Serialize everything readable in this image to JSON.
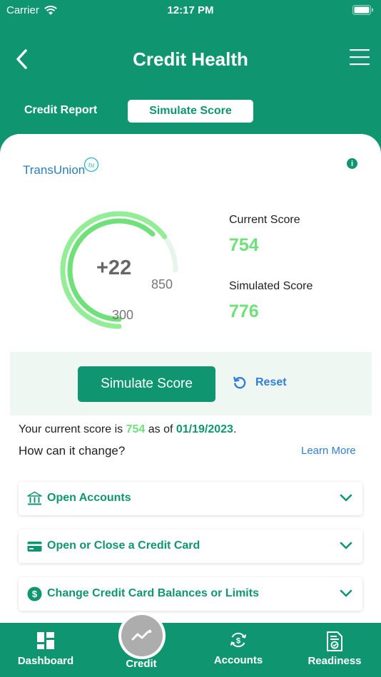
{
  "status_bar": {
    "carrier": "Carrier",
    "time": "12:17 PM"
  },
  "header": {
    "title": "Credit Health"
  },
  "tabs": [
    {
      "label": "Credit Report"
    },
    {
      "label": "Simulate Score"
    }
  ],
  "provider": {
    "name": "TransUnion",
    "mark": "tu"
  },
  "gauge": {
    "delta_label": "+22",
    "min_label": "300",
    "max_label": "850",
    "min": 300,
    "max": 850,
    "current": 754,
    "simulated": 776
  },
  "scores": {
    "current_label": "Current Score",
    "current_value": "754",
    "simulated_label": "Simulated Score",
    "simulated_value": "776"
  },
  "actions": {
    "simulate_label": "Simulate Score",
    "reset_label": "Reset"
  },
  "summary": {
    "prefix": "Your current score is ",
    "score": "754",
    "middle": " as of ",
    "date": "01/19/2023",
    "suffix": "."
  },
  "question": {
    "text": "How can it change?",
    "link": "Learn More"
  },
  "accordion": [
    {
      "label": "Open Accounts",
      "icon": "bank-icon"
    },
    {
      "label": "Open or Close a Credit Card",
      "icon": "credit-card-icon"
    },
    {
      "label": "Change Credit Card Balances or Limits",
      "icon": "dollar-icon"
    }
  ],
  "bottom_nav": [
    {
      "label": "Dashboard",
      "icon": "dashboard-icon"
    },
    {
      "label": "Credit",
      "icon": "trend-icon"
    },
    {
      "label": "Accounts",
      "icon": "accounts-icon"
    },
    {
      "label": "Readiness",
      "icon": "readiness-icon"
    }
  ],
  "colors": {
    "brand": "#0f9670",
    "score_green": "#6fe07a",
    "link_blue": "#2f7fd8",
    "panel_bg": "#eff7f3"
  }
}
